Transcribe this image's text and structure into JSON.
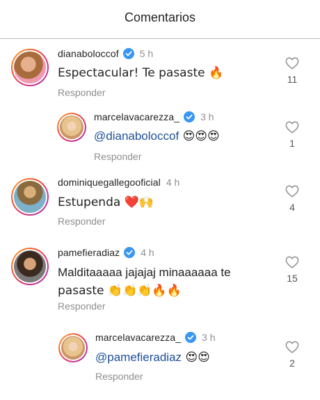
{
  "header": {
    "title": "Comentarios"
  },
  "comments": [
    {
      "username": "dianaboloccof",
      "verified": true,
      "time": "5 h",
      "text": "Espectacular! Te pasaste 🔥",
      "reply_label": "Responder",
      "likes": "11"
    },
    {
      "username": "marcelavacarezza_",
      "verified": true,
      "time": "3 h",
      "mention": "@dianaboloccof",
      "text_after": " 😍😍😍",
      "reply_label": "Responder",
      "likes": "1"
    },
    {
      "username": "dominiquegallegooficial",
      "verified": false,
      "time": "4 h",
      "text": "Estupenda ❤️🙌",
      "reply_label": "Responder",
      "likes": "4"
    },
    {
      "username": "pamefieradiaz",
      "verified": true,
      "time": "4 h",
      "text_line1": "Malditaaaaa jajajaj minaaaaaa  te",
      "text_line2": "pasaste 👏👏👏🔥🔥",
      "reply_label": "Responder",
      "likes": "15"
    },
    {
      "username": "marcelavacarezza_",
      "verified": true,
      "time": "3 h",
      "mention": "@pamefieradiaz",
      "text_after": " 😍😍",
      "reply_label": "Responder",
      "likes": "2"
    }
  ],
  "colors": {
    "verified": "#3897f0",
    "mention": "#1e4f96",
    "muted": "#8e8e8e"
  }
}
